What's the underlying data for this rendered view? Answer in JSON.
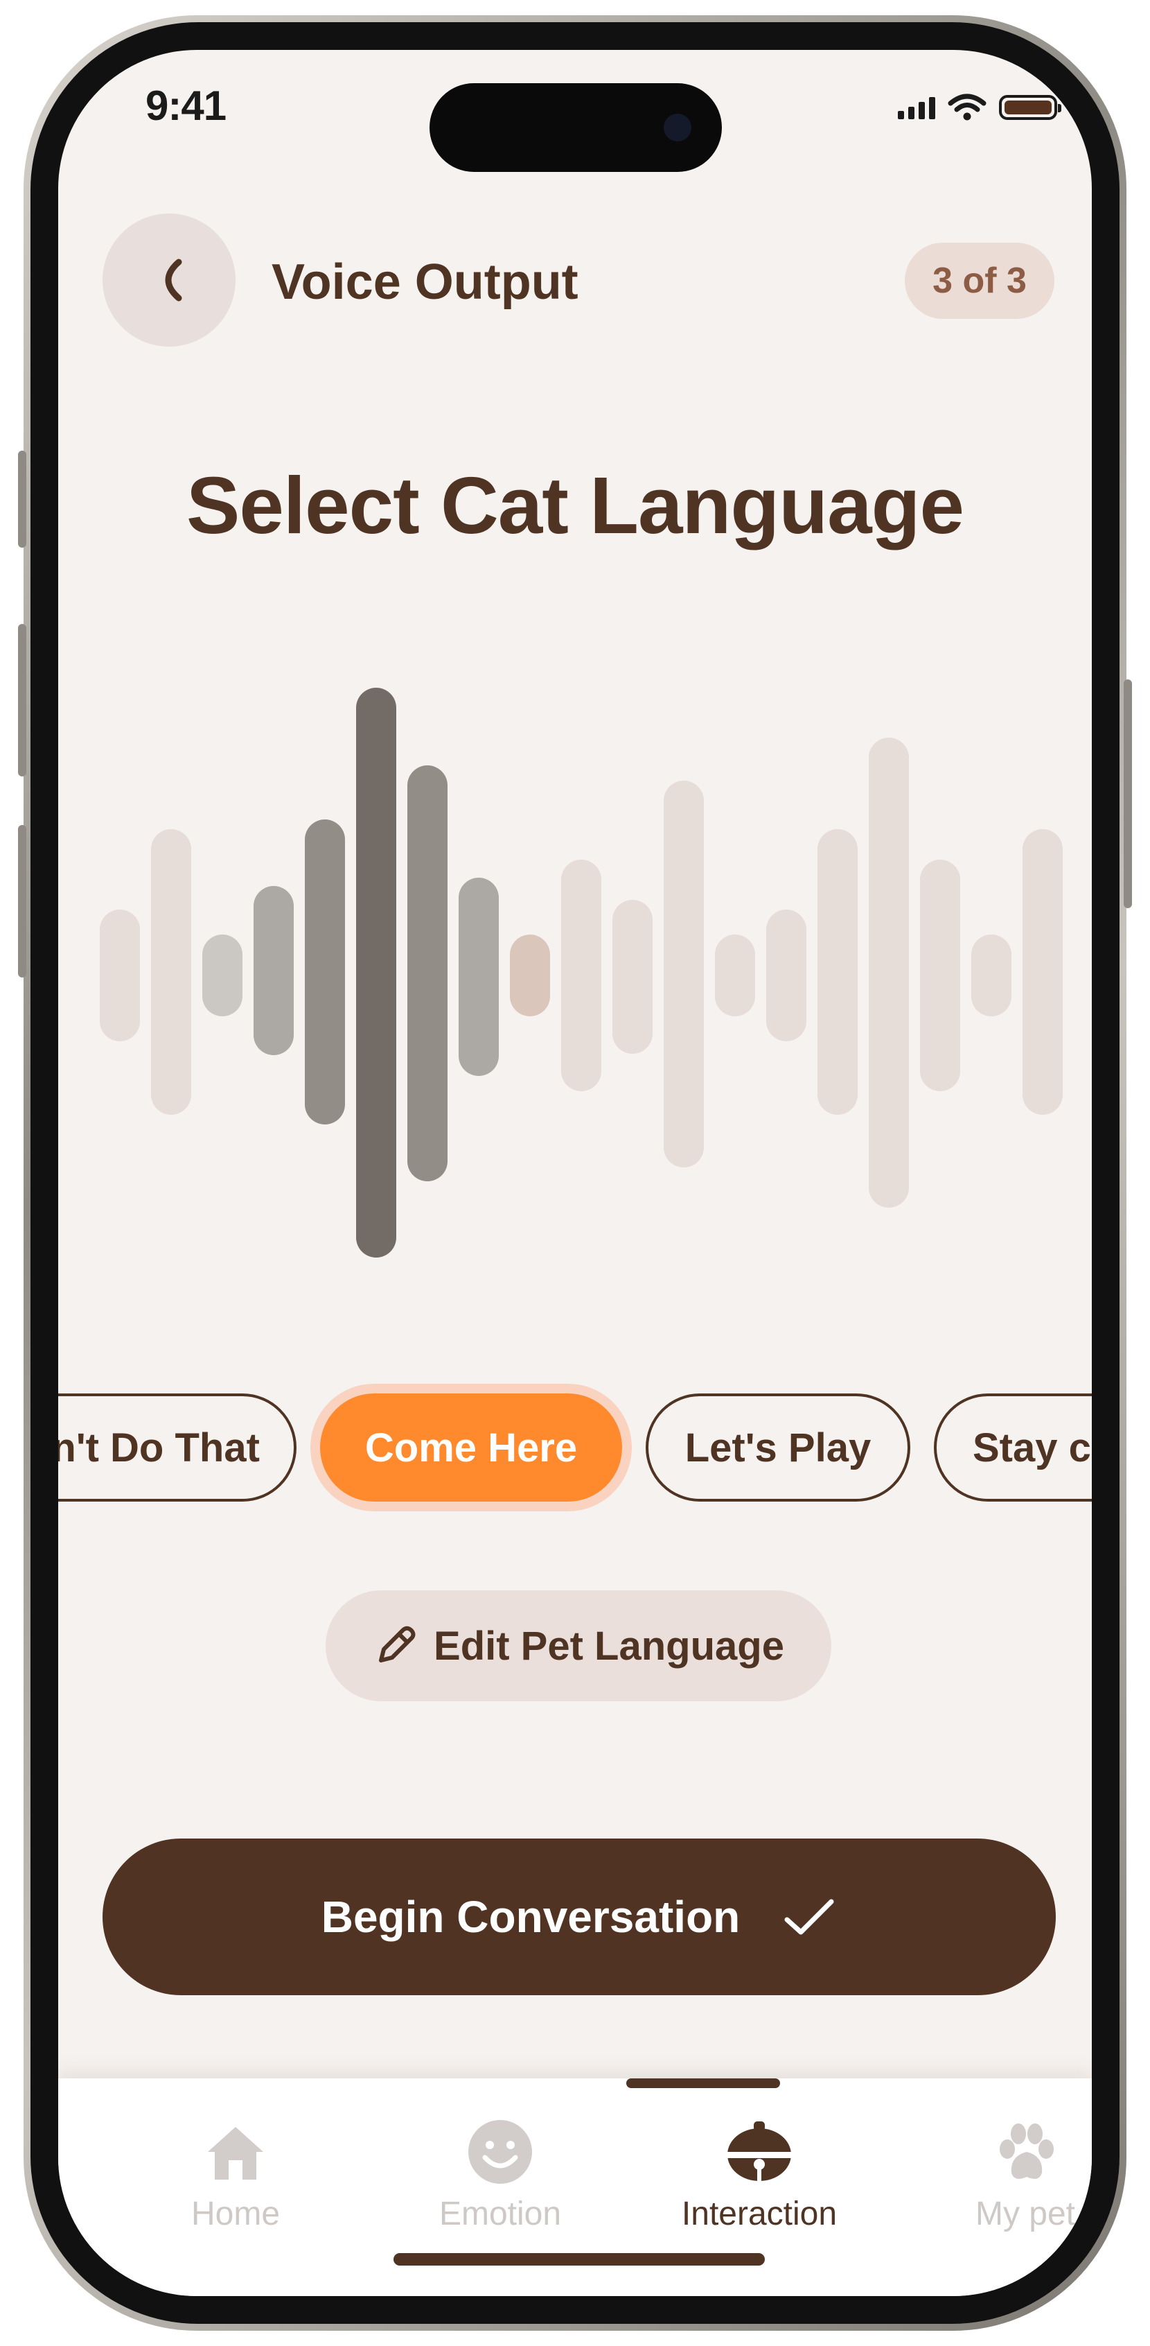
{
  "status_bar": {
    "time": "9:41"
  },
  "header": {
    "title": "Voice Output",
    "step": "3 of 3"
  },
  "main": {
    "title": "Select Cat Language"
  },
  "phrases": [
    {
      "label": "Don't Do That",
      "selected": false
    },
    {
      "label": "Come Here",
      "selected": true
    },
    {
      "label": "Let's Play",
      "selected": false
    },
    {
      "label": "Stay calm",
      "selected": false
    }
  ],
  "edit_button": {
    "label": "Edit Pet Language",
    "icon": "pencil-icon"
  },
  "primary_button": {
    "label": "Begin Conversation",
    "icon": "check-icon"
  },
  "tabs": [
    {
      "label": "Home",
      "icon": "house-icon",
      "active": false
    },
    {
      "label": "Emotion",
      "icon": "smiley-icon",
      "active": false
    },
    {
      "label": "Interaction",
      "icon": "bell-icon",
      "active": true
    },
    {
      "label": "My pet",
      "icon": "paw-icon",
      "active": false
    }
  ],
  "colors": {
    "brand_brown": "#4f3323",
    "accent_orange": "#ff8a2e",
    "background": "#f6f2ef"
  }
}
